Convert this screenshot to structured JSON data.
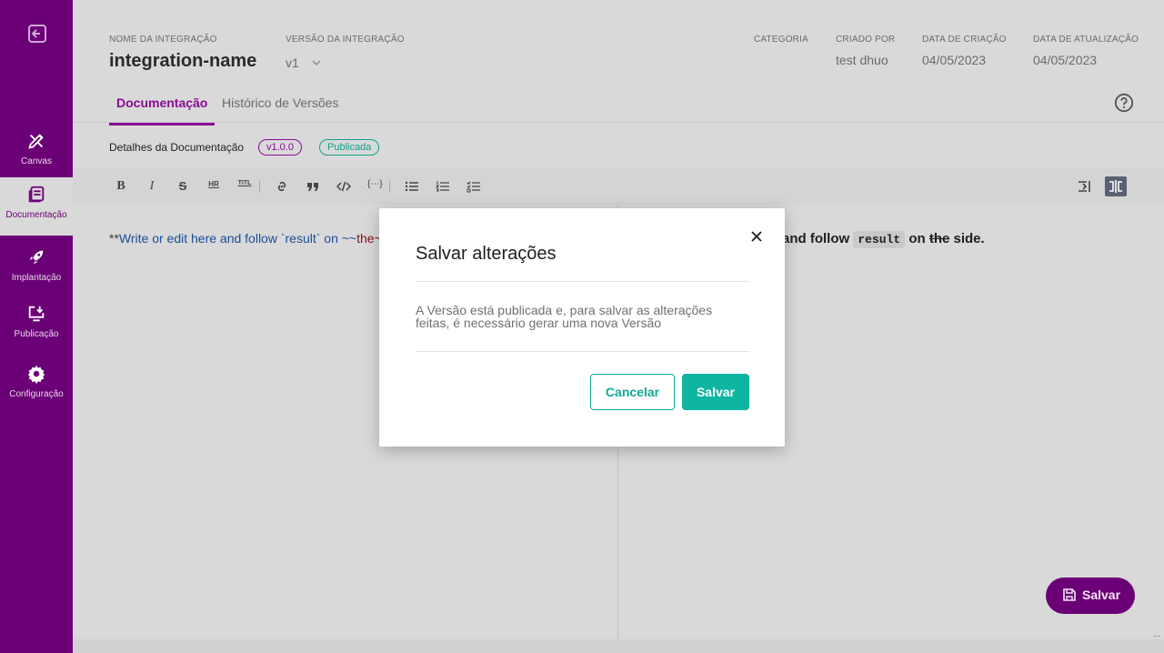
{
  "sidebar": {
    "items": [
      {
        "label": "Canvas",
        "icon": "canvas-icon"
      },
      {
        "label": "Documentação",
        "icon": "documentation-icon"
      },
      {
        "label": "Implantação",
        "icon": "rocket-icon"
      },
      {
        "label": "Publicação",
        "icon": "publish-icon"
      },
      {
        "label": "Configuração",
        "icon": "gear-icon"
      }
    ],
    "active": "Documentação",
    "color": "#6b0076"
  },
  "header": {
    "name_label": "NOME DA INTEGRAÇÃO",
    "name_value": "integration-name",
    "version_label": "VERSÃO DA INTEGRAÇÃO",
    "version_value": "v1",
    "category_label": "CATEGORIA",
    "category_value": "",
    "created_by_label": "CRIADO POR",
    "created_by_value": "test dhuo",
    "created_date_label": "DATA DE CRIAÇÃO",
    "created_date_value": "04/05/2023",
    "updated_date_label": "DATA DE ATUALIZAÇÃO",
    "updated_date_value": "04/05/2023"
  },
  "tabs": [
    {
      "label": "Documentação",
      "active": true
    },
    {
      "label": "Histórico de Versões",
      "active": false
    }
  ],
  "doc": {
    "details_label": "Detalhes da Documentação",
    "version_badge": "v1.0.0",
    "status_badge": "Publicada"
  },
  "editor": {
    "source_prefix": "**",
    "source_blue": "Write or edit here and follow `result` on ~~",
    "source_red": "the~",
    "preview_before": "and follow",
    "preview_code": "result",
    "preview_on": "on",
    "preview_strike": "the",
    "preview_after": "side.",
    "resize_handle": "..."
  },
  "fab": {
    "label": "Salvar"
  },
  "modal": {
    "title": "Salvar alterações",
    "body": "A Versão está publicada e, para salvar as alterações feitas, é necessário gerar uma nova Versão",
    "cancel_label": "Cancelar",
    "save_label": "Salvar"
  },
  "colors": {
    "accent_purple": "#6b0076",
    "teal": "#0fb5a1"
  }
}
